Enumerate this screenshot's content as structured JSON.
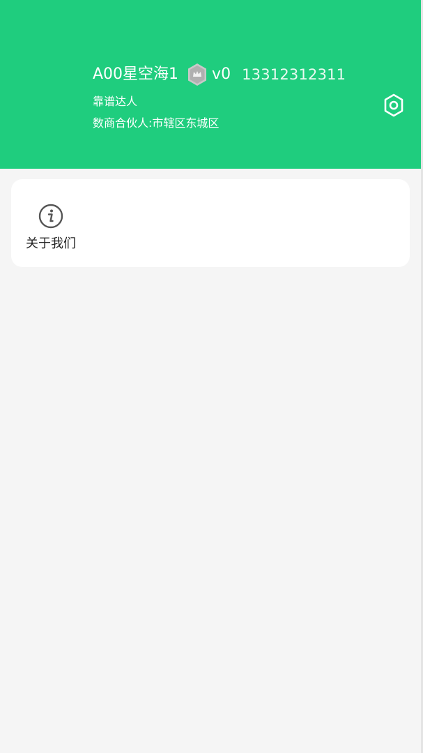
{
  "header": {
    "user_name": "A00星空海1",
    "level": "v0",
    "phone": "13312312311",
    "title": "靠谱达人",
    "partner": "数商合伙人:市辖区东城区",
    "badge_icon": "shield-crown-icon",
    "settings_icon": "hexagon-gear-icon",
    "background_color": "#1fcd7e"
  },
  "menu": {
    "items": [
      {
        "label": "关于我们",
        "icon": "info-circle-icon"
      }
    ]
  }
}
